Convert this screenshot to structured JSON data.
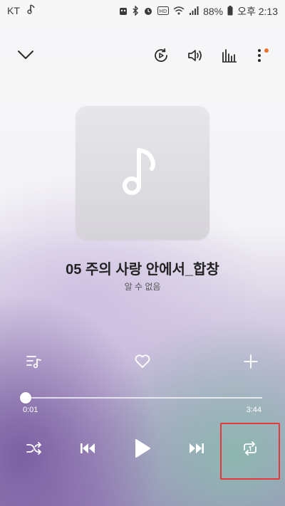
{
  "status": {
    "carrier": "KT",
    "battery_percent": "88%",
    "time": "오후 2:13"
  },
  "player": {
    "song_title": "05 주의 사랑 안에서_합창",
    "artist": "알 수 없음",
    "time_current": "0:01",
    "time_total": "3:44",
    "progress_fraction": 0.0045
  },
  "icons": {
    "collapse": "chevron-down-icon",
    "smart_view": "cast-icon",
    "volume": "volume-icon",
    "equalizer": "equalizer-icon",
    "more": "more-vertical-icon",
    "playlist": "playlist-icon",
    "favorite": "heart-icon",
    "add": "plus-icon",
    "shuffle": "shuffle-icon",
    "previous": "skip-previous-icon",
    "play": "play-icon",
    "next": "skip-next-icon",
    "repeat": "repeat-one-icon"
  },
  "colors": {
    "notification_dot": "#e8742a",
    "highlight_border": "#e23a3a"
  }
}
